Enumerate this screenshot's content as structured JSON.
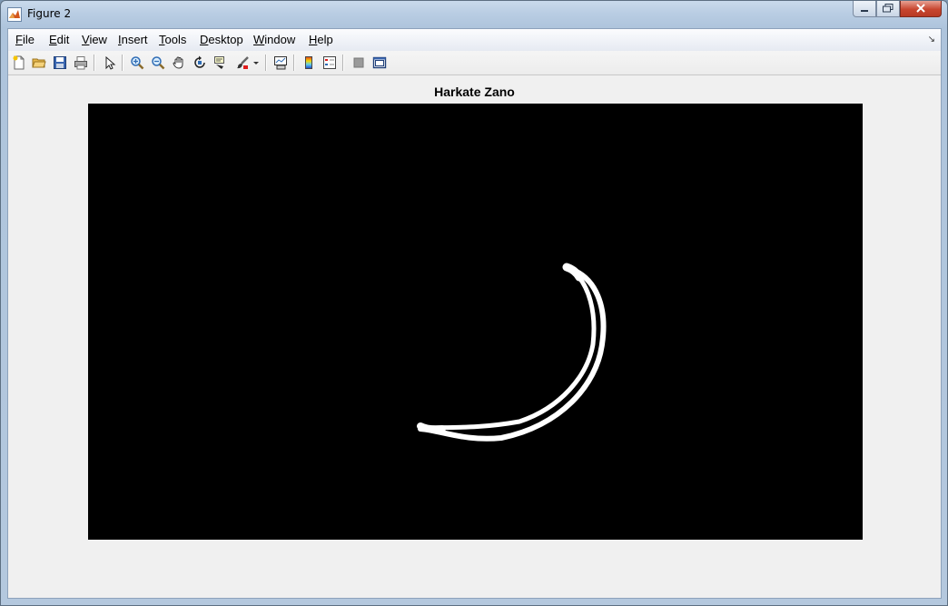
{
  "window": {
    "title": "Figure 2",
    "minimize_icon": "minimize-icon",
    "maximize_icon": "maximize-icon",
    "close_icon": "close-icon"
  },
  "menubar": {
    "items": [
      {
        "label": "File",
        "mnemonic": "F",
        "rest": "ile"
      },
      {
        "label": "Edit",
        "mnemonic": "E",
        "rest": "dit"
      },
      {
        "label": "View",
        "mnemonic": "V",
        "rest": "iew"
      },
      {
        "label": "Insert",
        "mnemonic": "I",
        "rest": "nsert"
      },
      {
        "label": "Tools",
        "mnemonic": "T",
        "rest": "ools"
      },
      {
        "label": "Desktop",
        "mnemonic": "D",
        "rest": "esktop"
      },
      {
        "label": "Window",
        "mnemonic": "W",
        "rest": "indow"
      },
      {
        "label": "Help",
        "mnemonic": "H",
        "rest": "elp"
      }
    ]
  },
  "toolbar": {
    "buttons": [
      "new-figure-icon",
      "open-file-icon",
      "save-figure-icon",
      "print-figure-icon",
      "edit-plot-icon",
      "zoom-in-icon",
      "zoom-out-icon",
      "pan-icon",
      "rotate-3d-icon",
      "data-cursor-icon",
      "brush-icon",
      "link-plot-icon",
      "insert-colorbar-icon",
      "insert-legend-icon",
      "hide-plot-tools-icon",
      "show-plot-tools-icon"
    ]
  },
  "axes": {
    "title": "Harkate Zano",
    "background": "#000000",
    "stroke_color": "#ffffff"
  }
}
